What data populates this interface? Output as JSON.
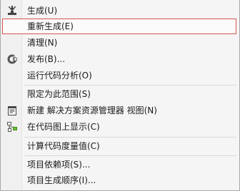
{
  "menu": {
    "items": [
      {
        "label": "生成(U)",
        "icon": "build-icon"
      },
      {
        "label": "重新生成(E)",
        "icon": ""
      },
      {
        "label": "清理(N)",
        "icon": ""
      },
      {
        "label": "发布(B)...",
        "icon": "publish-icon"
      },
      {
        "label": "运行代码分析(O)",
        "icon": ""
      },
      {
        "label": "限定为此范围(S)",
        "icon": ""
      },
      {
        "label": "新建 解决方案资源管理器 视图(N)",
        "icon": "new-view-icon"
      },
      {
        "label": "在代码图上显示(C)",
        "icon": "code-map-icon"
      },
      {
        "label": "计算代码度量值(C)",
        "icon": ""
      },
      {
        "label": "项目依赖项(S)...",
        "icon": ""
      },
      {
        "label": "项目生成顺序(I)...",
        "icon": ""
      }
    ]
  },
  "colors": {
    "highlight_border": "#d9534f",
    "background": "#f5f5f5"
  }
}
